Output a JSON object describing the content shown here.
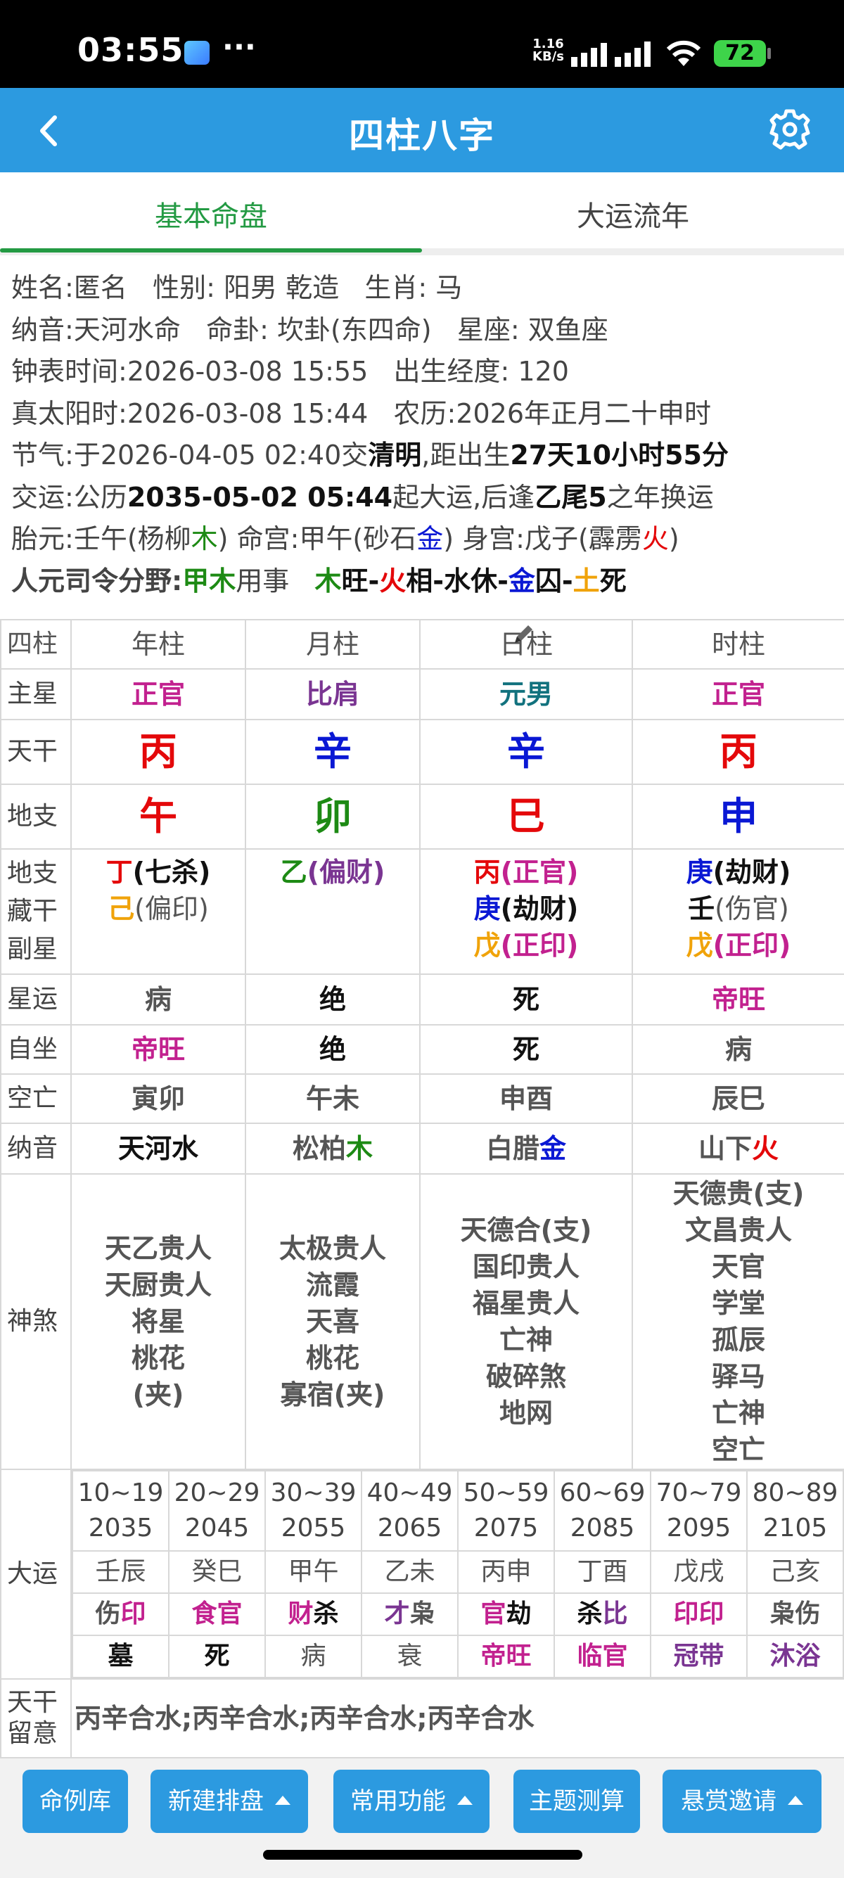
{
  "status": {
    "time": "03:55",
    "dots": "···",
    "speed_value": "1.16",
    "speed_unit": "KB/s",
    "battery": "72"
  },
  "appbar": {
    "title": "四柱八字",
    "back_icon": "chevron-left-icon",
    "settings_icon": "gear-icon"
  },
  "tabs": [
    {
      "label": "基本命盘",
      "active": true
    },
    {
      "label": "大运流年",
      "active": false
    }
  ],
  "info": {
    "l1": {
      "k1": "姓名:",
      "v1": "匿名",
      "k2": "性别:",
      "v2": "阳男 乾造",
      "k3": "生肖:",
      "v3": "马"
    },
    "l2": {
      "k1": "纳音:",
      "v1": "天河水命",
      "k2": "命卦:",
      "v2": "坎卦(东四命)",
      "k3": "星座:",
      "v3": "双鱼座"
    },
    "l3": {
      "k1": "钟表时间:",
      "v1": "2026-03-08 15:55",
      "k2": "出生经度:",
      "v2": "120"
    },
    "l4": {
      "k1": "真太阳时:",
      "v1": "2026-03-08 15:44",
      "k2": "农历:",
      "v2": "2026年正月二十申时"
    },
    "l5": {
      "k1": "节气:",
      "p1": "于2026-04-05 02:40交",
      "b1": "清明",
      "p2": ",距出生",
      "b2": "27天10小时55分"
    },
    "l6": {
      "k1": "交运:",
      "p1": "公历",
      "b1": "2035-05-02 05:44",
      "p2": "起大运,后逢",
      "b2": "乙尾5",
      "p3": "之年换运"
    },
    "l7": {
      "k1": "胎元:",
      "p1": "壬午(杨柳",
      "e1": "木",
      "p2": ")",
      "k2": "命宫:",
      "p3": "甲午(砂石",
      "e2": "金",
      "p4": ")",
      "k3": "身宫:",
      "p5": "戊子(霹雳",
      "e3": "火",
      "p6": ")"
    },
    "l8": {
      "k1": "人元司令分野:",
      "b1": "甲木",
      "p1": "用事",
      "w1": "木",
      "s1": "旺-",
      "w2": "火",
      "s2": "相-",
      "w3": "水",
      "s3": "休-",
      "w4": "金",
      "s4": "囚-",
      "w5": "土",
      "s5": "死"
    }
  },
  "table": {
    "headers": [
      "四柱",
      "年柱",
      "月柱",
      "日柱",
      "时柱"
    ],
    "edit_icon": "pencil-icon",
    "labels": {
      "zhuxing": "主星",
      "tiangan": "天干",
      "dizhi": "地支",
      "canggan": "地支藏干副星",
      "xingyun": "星运",
      "zizuo": "自坐",
      "kongwang": "空亡",
      "nayin": "纳音",
      "shensha": "神煞",
      "dayun": "大运",
      "liuyi": "天干留意"
    },
    "zhuxing": [
      "正官",
      "比肩",
      "元男",
      "正官"
    ],
    "tiangan": [
      "丙",
      "辛",
      "辛",
      "丙"
    ],
    "dizhi": [
      "午",
      "卯",
      "巳",
      "申"
    ],
    "canggan": [
      [
        {
          "gan": "丁",
          "star": "七杀"
        },
        {
          "gan": "己",
          "star": "偏印"
        }
      ],
      [
        {
          "gan": "乙",
          "star": "偏财"
        }
      ],
      [
        {
          "gan": "丙",
          "star": "正官"
        },
        {
          "gan": "庚",
          "star": "劫财"
        },
        {
          "gan": "戊",
          "star": "正印"
        }
      ],
      [
        {
          "gan": "庚",
          "star": "劫财"
        },
        {
          "gan": "壬",
          "star": "伤官"
        },
        {
          "gan": "戊",
          "star": "正印"
        }
      ]
    ],
    "xingyun": [
      "病",
      "绝",
      "死",
      "帝旺"
    ],
    "zizuo": [
      "帝旺",
      "绝",
      "死",
      "病"
    ],
    "kongwang": [
      "寅卯",
      "午未",
      "申酉",
      "辰巳"
    ],
    "nayin": [
      {
        "a": "天河",
        "e": "水"
      },
      {
        "a": "松柏",
        "e": "木"
      },
      {
        "a": "白腊",
        "e": "金"
      },
      {
        "a": "山下",
        "e": "火"
      }
    ],
    "shensha": [
      [
        "天乙贵人",
        "天厨贵人",
        "将星",
        "桃花",
        "(夹)"
      ],
      [
        "太极贵人",
        "流霞",
        "天喜",
        "桃花",
        "寡宿(夹)"
      ],
      [
        "天德合(支)",
        "国印贵人",
        "福星贵人",
        "亡神",
        "破碎煞",
        "地网"
      ],
      [
        "天德贵(支)",
        "文昌贵人",
        "天官",
        "学堂",
        "孤辰",
        "驿马",
        "亡神",
        "空亡"
      ]
    ],
    "dayun": [
      {
        "age": "10~19",
        "year": "2035",
        "gz": "壬辰",
        "g1": "伤",
        "g2": "印",
        "cs": "墓"
      },
      {
        "age": "20~29",
        "year": "2045",
        "gz": "癸巳",
        "g1": "食",
        "g2": "官",
        "cs": "死"
      },
      {
        "age": "30~39",
        "year": "2055",
        "gz": "甲午",
        "g1": "财",
        "g2": "杀",
        "cs": "病"
      },
      {
        "age": "40~49",
        "year": "2065",
        "gz": "乙未",
        "g1": "才",
        "g2": "枭",
        "cs": "衰"
      },
      {
        "age": "50~59",
        "year": "2075",
        "gz": "丙申",
        "g1": "官",
        "g2": "劫",
        "cs": "帝旺"
      },
      {
        "age": "60~69",
        "year": "2085",
        "gz": "丁酉",
        "g1": "杀",
        "g2": "比",
        "cs": "临官"
      },
      {
        "age": "70~79",
        "year": "2095",
        "gz": "戊戌",
        "g1": "印",
        "g2": "印",
        "cs": "冠带"
      },
      {
        "age": "80~89",
        "year": "2105",
        "gz": "己亥",
        "g1": "枭",
        "g2": "伤",
        "cs": "沐浴"
      }
    ],
    "liuyi": "丙辛合水;丙辛合水;丙辛合水;丙辛合水"
  },
  "bottom": {
    "b1": "命例库",
    "b2": "新建排盘",
    "b3": "常用功能",
    "b4": "主题测算",
    "b5": "悬赏邀请"
  },
  "colors": {
    "appbar": "#2c9ae0",
    "tab_active": "#239a43",
    "fire": "#e4080a",
    "metal": "#0a18d4",
    "wood": "#1d8a14",
    "earth": "#f0a30a",
    "star_magenta": "#c2218f",
    "star_purple": "#7a3592",
    "yuannan_teal": "#12727e"
  }
}
